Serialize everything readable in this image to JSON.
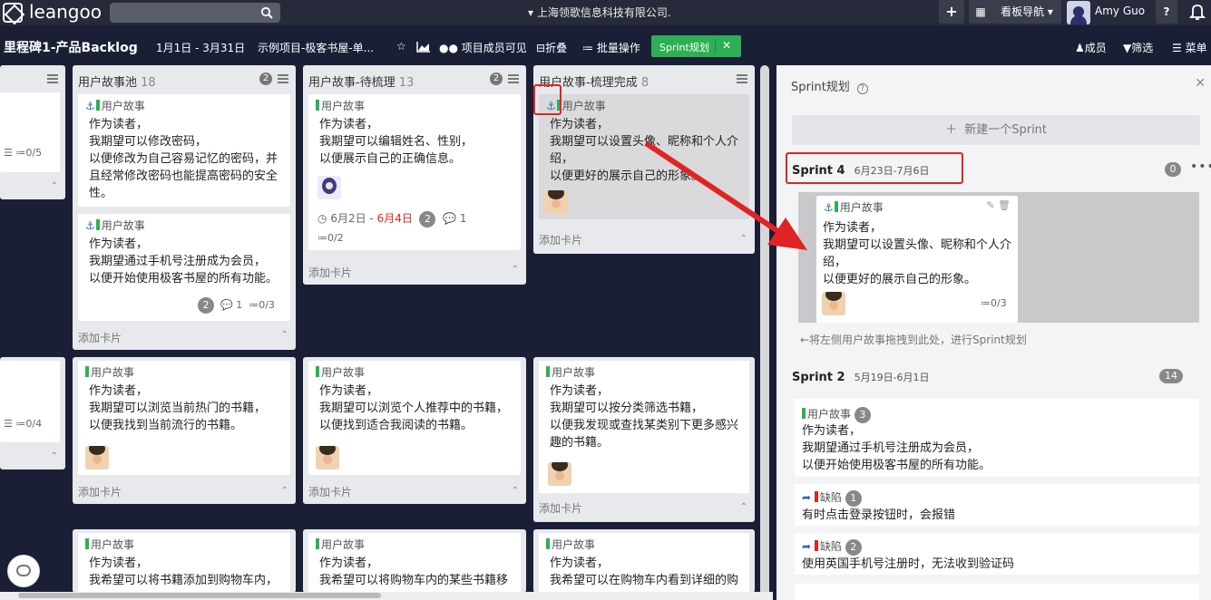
{
  "topbar": {
    "logo": "leangoo",
    "company": "上海领歌信息科技有限公司.",
    "nav_label": "看板导航",
    "user": "Amy Guo",
    "help": "?"
  },
  "subbar": {
    "board_title": "里程碑1-产品Backlog",
    "dates": "1月1日 - 3月31日",
    "project": "示例项目-极客书屋-单...",
    "visibility": "项目成员可见",
    "fold": "折叠",
    "batch": "批量操作",
    "sprint_plan": "Sprint规划",
    "members": "成员",
    "filter": "筛选",
    "menu": "菜单"
  },
  "lanes": [
    {
      "title": "用户故事池",
      "count": "18",
      "badge": "2"
    },
    {
      "title": "用户故事-待梳理",
      "count": "13",
      "badge": "2"
    },
    {
      "title": "用户故事-梳理完成",
      "count": "8"
    }
  ],
  "common": {
    "story": "用户故事",
    "bug": "缺陷",
    "add_card": "添加卡片"
  },
  "cards": {
    "l0a_check": "0/5",
    "l0b_check": "0/4",
    "c1": "作为读者，\n我期望可以修改密码，\n以便修改为自己容易记忆的密码，并\n且经常修改密码也能提高密码的安全\n性。",
    "c2": "作为读者，\n我期望通过手机号注册成为会员，\n以便开始使用极客书屋的所有功能。",
    "c2_badge": "2",
    "c2_comments": "1",
    "c2_check": "0/3",
    "c3": "作为读者，\n我期望可以编辑姓名、性别，\n以便展示自己的正确信息。",
    "c3_date_start": "6月2日",
    "c3_date_end": "6月4日",
    "c3_badge": "2",
    "c3_comments": "1",
    "c3_check": "0/2",
    "c4": "作为读者，\n我期望可以设置头像、昵称和个人介\n绍，\n以便更好的展示自己的形象。",
    "c5": "作为读者，\n我期望可以浏览当前热门的书籍，\n以便我找到当前流行的书籍。",
    "c6": "作为读者，\n我期望可以浏览个人推荐中的书籍，\n以便找到适合我阅读的书籍。",
    "c7": "作为读者，\n我期望可以按分类筛选书籍，\n以便我发现或查找某类别下更多感兴\n趣的书籍。",
    "c8": "作为读者，\n我希望可以将书籍添加到购物车内，",
    "c9": "作为读者，\n我希望可以将购物车内的某些书籍移",
    "c10": "作为读者，\n我希望可以在购物车内看到详细的购"
  },
  "panel": {
    "title": "Sprint规划",
    "new_sprint": "新建一个Sprint",
    "sprint4": {
      "name": "Sprint 4",
      "dates": "6月23日-7月6日",
      "count": "0",
      "card": "作为读者，\n我期望可以设置头像、昵称和个人介\n绍，\n以便更好的展示自己的形象。",
      "check": "0/3"
    },
    "hint": "←将左侧用户故事拖拽到此处，进行Sprint规划",
    "sprint2": {
      "name": "Sprint 2",
      "dates": "5月19日-6月1日",
      "count": "14",
      "items": [
        {
          "badge": "3",
          "text": "作为读者，\n我期望通过手机号注册成为会员，\n以便开始使用极客书屋的所有功能。"
        },
        {
          "badge": "1",
          "text": "有时点击登录按钮时，会报错"
        },
        {
          "badge": "2",
          "text": "使用英国手机号注册时，无法收到验证码"
        }
      ]
    }
  },
  "colors": {
    "accent_green": "#2db055",
    "bug_red": "#e02424",
    "annotation_red": "#e02424",
    "link_blue": "#2b6cb0"
  }
}
